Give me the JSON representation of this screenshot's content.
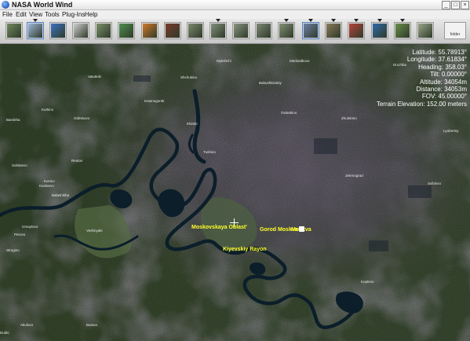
{
  "window": {
    "title": "NASA World Wind",
    "controls": [
      "_",
      "□",
      "×"
    ]
  },
  "menu": [
    "File",
    "Edit",
    "View",
    "Tools",
    "Plug-Ins",
    "Help"
  ],
  "toolbar": {
    "buttons": [
      {
        "icon": "satellite-icon",
        "color": "#6f8a5e"
      },
      {
        "icon": "grid-icon",
        "color": "#9fb7d9"
      },
      {
        "icon": "globe-icon",
        "color": "#3c74c2"
      },
      {
        "icon": "magnifier-icon",
        "color": "#cfcfcf"
      },
      {
        "icon": "layer-landsat-icon",
        "color": "#7a8f6a"
      },
      {
        "icon": "layer-map-icon",
        "color": "#4e8f4e"
      },
      {
        "icon": "layer-weather-icon",
        "color": "#d07a2a"
      },
      {
        "icon": "layer-fire-icon",
        "color": "#7a3a2a"
      },
      {
        "icon": "layer-scene-icon",
        "color": "#7d8a6c"
      },
      {
        "icon": "layer-scene-icon",
        "color": "#82907a"
      },
      {
        "icon": "layer-scene-icon",
        "color": "#8a9480"
      },
      {
        "icon": "layer-scene-icon",
        "color": "#7d8774"
      },
      {
        "icon": "layer-scene-icon",
        "color": "#838f76"
      },
      {
        "icon": "layer-city-icon",
        "color": "#6f82a8"
      },
      {
        "icon": "layer-terrain-icon",
        "color": "#8a7a5a"
      },
      {
        "icon": "layer-flag-icon",
        "color": "#b8443a"
      },
      {
        "icon": "compass-icon",
        "color": "#2f6aa8"
      },
      {
        "icon": "usa-map-icon",
        "color": "#6a8f4a"
      },
      {
        "icon": "place-names-icon",
        "color": "#9aa68a"
      }
    ],
    "folder_label": "folder"
  },
  "hud": [
    "Latitude: 55.78913°",
    "Longitude: 37.61834°",
    "Heading: 358.03°",
    "Tilt: 0.00000°",
    "Altitude: 34054m",
    "Distance: 34053m",
    "FOV: 45.00000°",
    "Terrain Elevation: 152.00 meters"
  ],
  "places": [
    "Moskovskaya Oblast'",
    "Gorod Moskva",
    "Moskva",
    "Kiyevskiy Rayon"
  ],
  "towns": [
    "Vatutinki",
    "Odintsovo",
    "Barvikha",
    "Solntsevo",
    "Kurkino",
    "Mytishchi",
    "Babushkinskiy",
    "Krasnogorsk",
    "Zhulebino",
    "Druzhba",
    "Lyubertsy",
    "Dubki",
    "Akulovo",
    "Butovo",
    "Zelenograd",
    "Khimki",
    "Tushino",
    "Kuntsevo",
    "Izmaylovo",
    "Perovo",
    "Veshnyaki",
    "Kosino",
    "Reutov",
    "Balashikha",
    "Medvedkovo",
    "Ostankino",
    "Sviblovo",
    "Koptevo",
    "Strogino",
    "Shchukino"
  ]
}
